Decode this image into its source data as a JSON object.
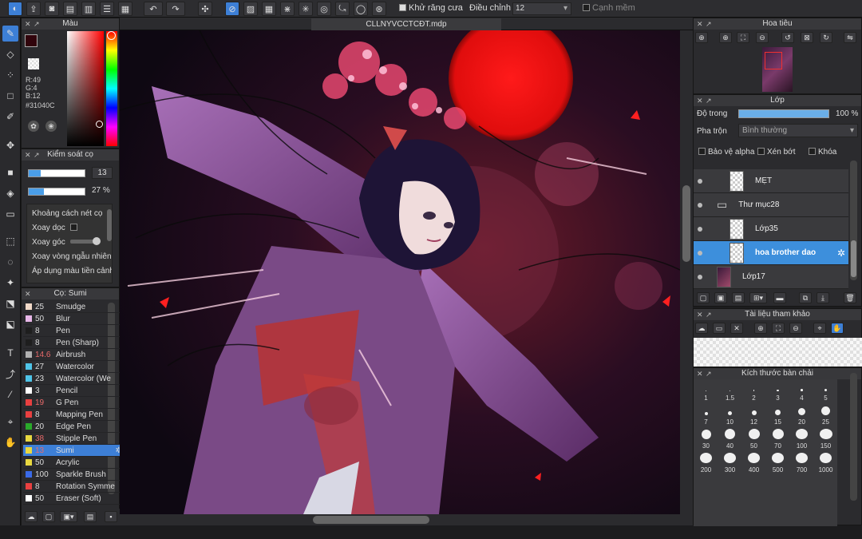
{
  "document": {
    "title": "CLLNYVCCTCĐT.mdp"
  },
  "toolbar": {
    "antialias_label": "Khử răng cưa",
    "adjust_label": "Điều chỉnh",
    "adjust_value": "12",
    "edge_label": "Cạnh mềm"
  },
  "color_panel": {
    "title": "Màu",
    "r": "R:49",
    "g": "G:4",
    "b": "B:12",
    "hex": "#31040C",
    "current_color": "#31040C"
  },
  "brush_control": {
    "title": "Kiểm soát cọ",
    "size_value": "13",
    "opacity_value": "27 %",
    "options": [
      "Khoảng cách nét cọ",
      "Xoay dọc",
      "Xoay góc",
      "Xoay vòng ngẫu nhiên",
      "Áp dụng màu tiền cảnh"
    ]
  },
  "brush_list": {
    "title": "Cọ: Sumi",
    "items": [
      {
        "size": "25",
        "name": "Smudge",
        "color": "#f1d9c8"
      },
      {
        "size": "50",
        "name": "Blur",
        "color": "#e7b7e8"
      },
      {
        "size": "8",
        "name": "Pen",
        "color": "#1e1e1e"
      },
      {
        "size": "8",
        "name": "Pen (Sharp)",
        "color": "#1e1e1e"
      },
      {
        "size": "14.6",
        "name": "Airbrush",
        "color": "#b0b0b0"
      },
      {
        "size": "27",
        "name": "Watercolor",
        "color": "#4fc4e8"
      },
      {
        "size": "23",
        "name": "Watercolor (We",
        "color": "#4fc4e8"
      },
      {
        "size": "3",
        "name": "Pencil",
        "color": "#ffffff"
      },
      {
        "size": "19",
        "name": "G Pen",
        "color": "#e84040"
      },
      {
        "size": "8",
        "name": "Mapping Pen",
        "color": "#e84040"
      },
      {
        "size": "20",
        "name": "Edge Pen",
        "color": "#2aaa2a"
      },
      {
        "size": "38",
        "name": "Stipple Pen",
        "color": "#e8d840"
      },
      {
        "size": "13",
        "name": "Sumi",
        "color": "#e8d840"
      },
      {
        "size": "50",
        "name": "Acrylic",
        "color": "#e8d840"
      },
      {
        "size": "100",
        "name": "Sparkle Brush",
        "color": "#3a6ae8"
      },
      {
        "size": "8",
        "name": "Rotation Symme",
        "color": "#e84040"
      },
      {
        "size": "50",
        "name": "Eraser (Soft)",
        "color": "#ffffff"
      }
    ]
  },
  "navigator": {
    "title": "Hoa tiêu"
  },
  "layer_panel": {
    "title": "Lớp",
    "opacity_label": "Độ trong",
    "opacity_value": "100 %",
    "opacity_fraction": 1.0,
    "blend_label": "Pha trộn",
    "blend_value": "Bình thường",
    "protect_alpha": "Bảo vệ alpha",
    "clipping": "Xén bớt",
    "lock": "Khóa",
    "layers": [
      {
        "name": "MẸT",
        "type": "layer"
      },
      {
        "name": "Thư mục28",
        "type": "folder"
      },
      {
        "name": "Lớp35",
        "type": "layer"
      },
      {
        "name": "hoa brother dao",
        "type": "layer"
      },
      {
        "name": "Lớp17",
        "type": "layer"
      }
    ]
  },
  "reference_panel": {
    "title": "Tài liệu tham khảo"
  },
  "brush_size_panel": {
    "title": "Kích thước bàn chải",
    "sizes": [
      "1",
      "1.5",
      "2",
      "3",
      "4",
      "5",
      "7",
      "10",
      "12",
      "15",
      "20",
      "25",
      "30",
      "40",
      "50",
      "70",
      "100",
      "150",
      "200",
      "300",
      "400",
      "500",
      "700",
      "1000"
    ]
  }
}
